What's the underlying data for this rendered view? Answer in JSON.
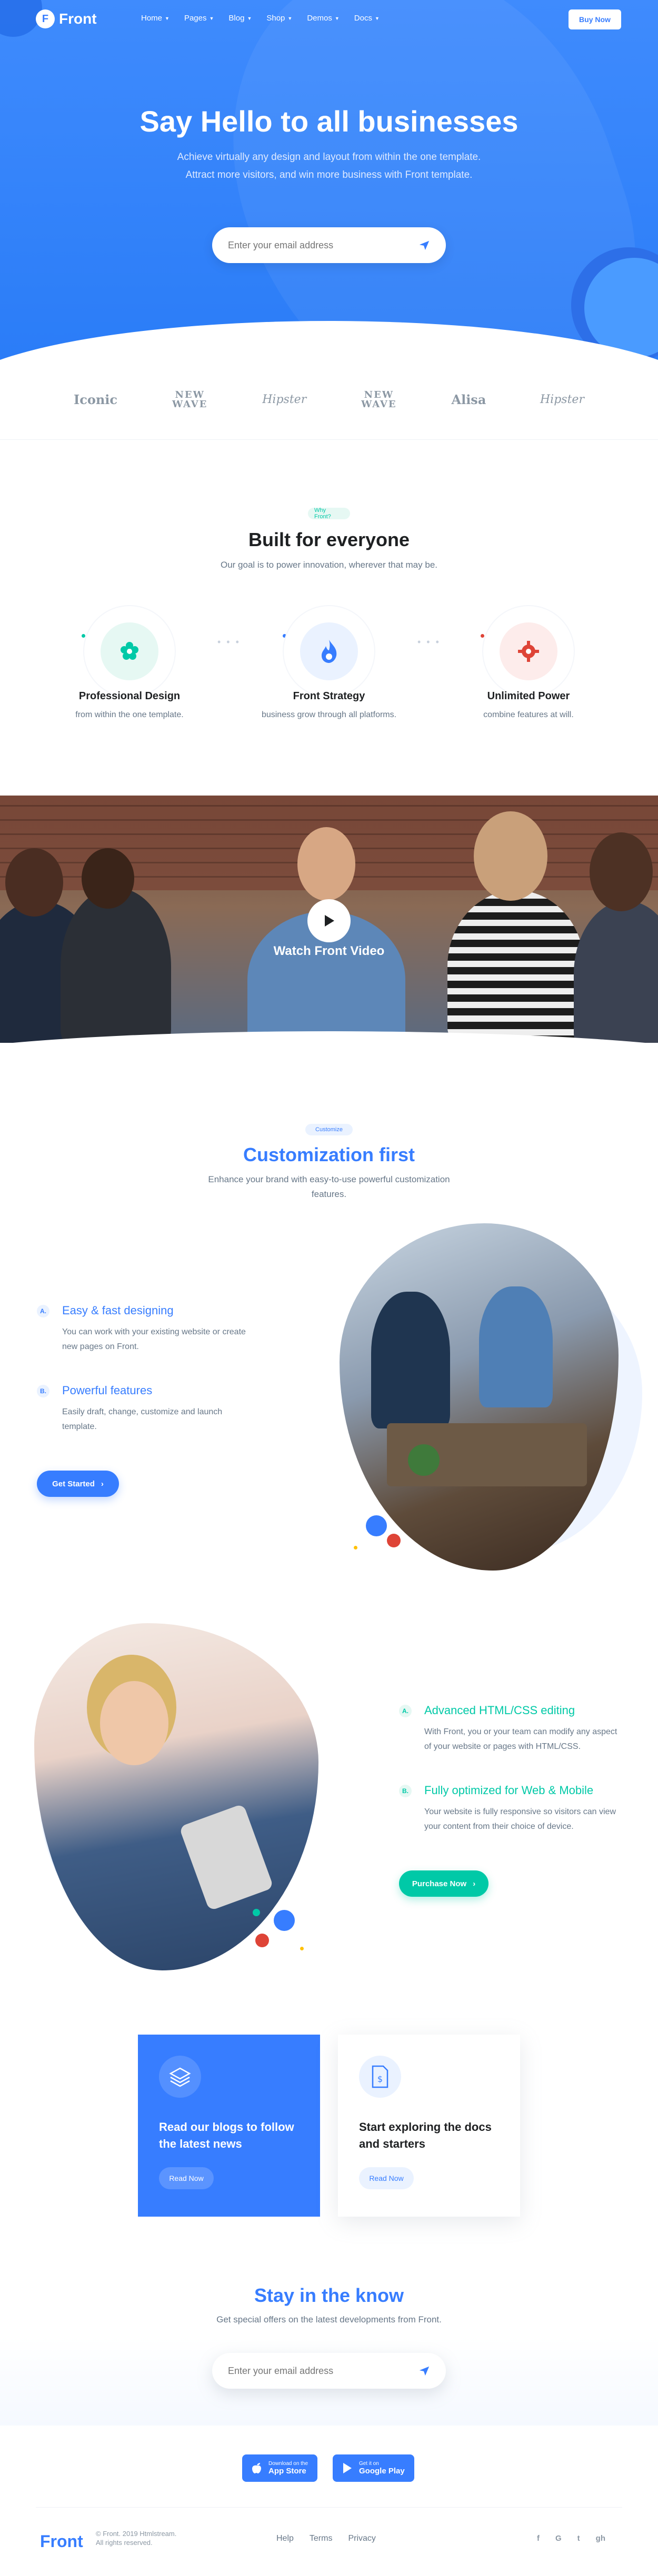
{
  "nav": {
    "logo_text": "Front",
    "logo_mark": "F",
    "items": [
      {
        "label": "Home"
      },
      {
        "label": "Pages"
      },
      {
        "label": "Blog"
      },
      {
        "label": "Shop"
      },
      {
        "label": "Demos"
      },
      {
        "label": "Docs"
      }
    ],
    "buy_label": "Buy Now"
  },
  "hero": {
    "title_pre": "Say ",
    "title_bold": "Hello",
    "title_post": " to all businesses",
    "subtitle": "Achieve virtually any design and layout from within the one template. Attract more visitors, and win more business with Front template.",
    "email_placeholder": "Enter your email address"
  },
  "clients": [
    "Iconic",
    "NEW WAVE",
    "Hipster",
    "NEW WAVE",
    "Alisa",
    "Hipster"
  ],
  "why": {
    "badge": "Why Front?",
    "title": "Built for everyone",
    "subtitle": "Our goal is to power innovation, wherever that may be.",
    "features": [
      {
        "title": "Professional Design",
        "text": "from within the one template.",
        "icon": "flower-icon"
      },
      {
        "title": "Front Strategy",
        "text": "business grow through all platforms.",
        "icon": "flame-icon"
      },
      {
        "title": "Unlimited Power",
        "text": "combine features at will.",
        "icon": "gear-icon"
      }
    ]
  },
  "video": {
    "label": "Watch Front Video"
  },
  "custom": {
    "badge": "Customize",
    "title_pre": "Customization ",
    "title_bold": "first",
    "subtitle": "Enhance your brand with easy-to-use powerful customization features.",
    "rows": [
      {
        "letter": "A.",
        "title": "Easy & fast designing",
        "text": "You can work with your existing website or create new pages on Front."
      },
      {
        "letter": "B.",
        "title": "Powerful features",
        "text": "Easily draft, change, customize and launch template."
      }
    ],
    "button": "Get Started"
  },
  "advanced": {
    "rows": [
      {
        "letter": "A.",
        "title": "Advanced HTML/CSS editing",
        "text": "With Front, you or your team can modify any aspect of your website or pages with HTML/CSS."
      },
      {
        "letter": "B.",
        "title": "Fully optimized for Web & Mobile",
        "text": "Your website is fully responsive so visitors can view your content from their choice of device."
      }
    ],
    "button": "Purchase Now"
  },
  "cards": [
    {
      "title": "Read our blogs to follow the latest news",
      "button": "Read Now",
      "icon": "layers-icon"
    },
    {
      "title": "Start exploring the docs and starters",
      "button": "Read Now",
      "icon": "document-icon"
    }
  ],
  "subscribe": {
    "title_bold": "Stay",
    "title_post": " in the know",
    "subtitle": "Get special offers on the latest developments from Front.",
    "placeholder": "Enter your email address"
  },
  "stores": [
    {
      "small": "Download on the",
      "big": "App Store",
      "icon": "apple-icon"
    },
    {
      "small": "Get it on",
      "big": "Google Play",
      "icon": "play-icon"
    }
  ],
  "footer": {
    "logo": "Front",
    "copyright_line1": "© Front. 2019 Htmlstream.",
    "copyright_line2": "All rights reserved.",
    "links": [
      "Help",
      "Terms",
      "Privacy"
    ],
    "social": [
      "f",
      "G",
      "t",
      "gh"
    ]
  },
  "colors": {
    "primary": "#377dff",
    "accent_green": "#00c9a7",
    "danger": "#de4437",
    "hero_bg": "#2a7cf7"
  }
}
